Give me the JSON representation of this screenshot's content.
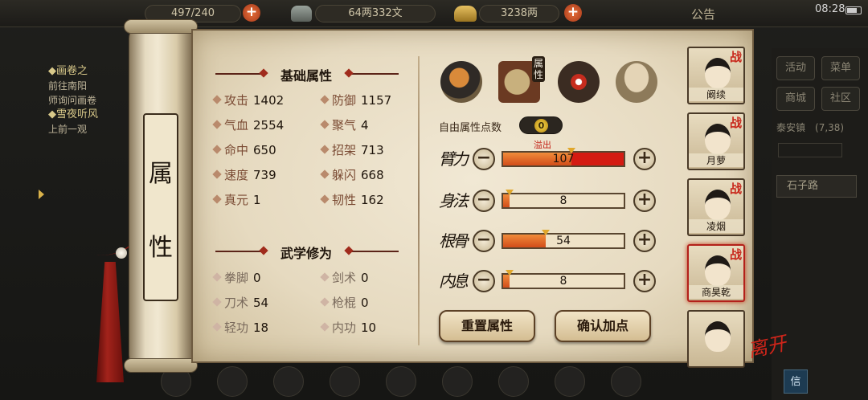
{
  "topbar": {
    "stamina": "497/240",
    "coins": "64两332文",
    "gold": "3238两",
    "notice": "公告",
    "clock": "08:28"
  },
  "left_panel": {
    "quest1_title": "◆画卷之",
    "quest1_desc1": "前往南阳",
    "quest1_desc2": "师询问画卷",
    "quest2_title": "◆雪夜听风",
    "quest2_desc": "上前一观"
  },
  "right_panel": {
    "btn_activity": "活动",
    "btn_menu": "菜单",
    "btn_shop": "商城",
    "btn_community": "社区",
    "location": "泰安镇",
    "coords": "(7,38)",
    "road": "石子路",
    "mail": "信"
  },
  "scroll": {
    "title_chars": [
      "属",
      "性"
    ]
  },
  "basic": {
    "title": "基础属性",
    "stats": [
      {
        "label": "攻击",
        "value": "1402"
      },
      {
        "label": "防御",
        "value": "1157"
      },
      {
        "label": "气血",
        "value": "2554"
      },
      {
        "label": "聚气",
        "value": "4"
      },
      {
        "label": "命中",
        "value": "650"
      },
      {
        "label": "招架",
        "value": "713"
      },
      {
        "label": "速度",
        "value": "739"
      },
      {
        "label": "躲闪",
        "value": "668"
      },
      {
        "label": "真元",
        "value": "1"
      },
      {
        "label": "韧性",
        "value": "162"
      }
    ]
  },
  "martial": {
    "title": "武学修为",
    "stats": [
      {
        "label": "拳脚",
        "value": "0"
      },
      {
        "label": "剑术",
        "value": "0"
      },
      {
        "label": "刀术",
        "value": "54"
      },
      {
        "label": "枪棍",
        "value": "0"
      },
      {
        "label": "轻功",
        "value": "18"
      },
      {
        "label": "内功",
        "value": "10"
      }
    ]
  },
  "tabs": {
    "attr_label": "属性",
    "icons": [
      "equipment-icon",
      "attribute-scroll-icon",
      "bagua-icon",
      "body-icon"
    ]
  },
  "points": {
    "free_label": "自由属性点数",
    "free_value": "0",
    "overflow_label": "溢出",
    "attributes": [
      {
        "label": "臂力",
        "value": "107",
        "fill": 1.0,
        "overflow": 0.43
      },
      {
        "label": "身法",
        "value": "8",
        "fill": 0.05,
        "overflow": 0
      },
      {
        "label": "根骨",
        "value": "54",
        "fill": 0.35,
        "overflow": 0
      },
      {
        "label": "内息",
        "value": "8",
        "fill": 0.05,
        "overflow": 0
      }
    ],
    "minus_glyph": "−",
    "plus_glyph": "+"
  },
  "actions": {
    "reset": "重置属性",
    "confirm": "确认加点"
  },
  "characters": [
    {
      "name": "阚续",
      "war": "战",
      "selected": false
    },
    {
      "name": "月萝",
      "war": "战",
      "selected": false
    },
    {
      "name": "凌烟",
      "war": "战",
      "selected": false
    },
    {
      "name": "商昊乾",
      "war": "战",
      "selected": true
    },
    {
      "name": "",
      "war": "",
      "selected": false
    }
  ],
  "leave_label": "离开",
  "colors": {
    "paper": "#e6dac0",
    "accent_red": "#c8261a",
    "bar_fill": "#e06a2a",
    "bar_overflow": "#d41b12"
  }
}
